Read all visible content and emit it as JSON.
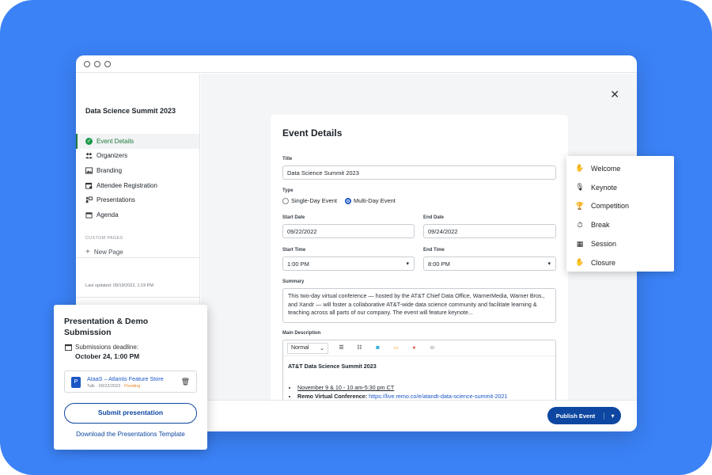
{
  "colors": {
    "background": "#3b82f6",
    "primary": "#0d47a1",
    "active_nav": "#1f7a3a",
    "pending": "#e6862a"
  },
  "sidebar": {
    "event_title": "Data Science Summit 2023",
    "items": [
      {
        "label": "Event Details",
        "icon": "check-circle-icon",
        "active": true
      },
      {
        "label": "Organizers",
        "icon": "people-icon"
      },
      {
        "label": "Branding",
        "icon": "image-icon"
      },
      {
        "label": "Attendee Registration",
        "icon": "calendar-user-icon"
      },
      {
        "label": "Presentations",
        "icon": "presenter-icon"
      },
      {
        "label": "Agenda",
        "icon": "calendar-icon"
      }
    ],
    "custom_pages_label": "CUSTOM PAGES",
    "new_page_label": "New Page",
    "last_updated": "Last updated: 09/19/2022, 1:19 PM"
  },
  "form": {
    "heading": "Event Details",
    "title_label": "Title",
    "title_value": "Data Science Summit 2023",
    "type_label": "Type",
    "type_options": [
      "Single-Day Event",
      "Multi-Day Event"
    ],
    "type_selected": "Multi-Day Event",
    "start_date_label": "Start Date",
    "start_date": "09/22/2022",
    "end_date_label": "End Date",
    "end_date": "09/24/2022",
    "start_time_label": "Start Time",
    "start_time": "1:00 PM",
    "end_time_label": "End Time",
    "end_time": "8:00 PM",
    "summary_label": "Summary",
    "summary": "This two-day virtual conference — hosted by the AT&T Chief Data Office, WarnerMedia, Warner Bros., and Xandr — will foster a collaborative AT&T-wide data science community and facilitate learning & teaching across all parts of our company. The event will feature keynote...",
    "main_description_label": "Main Description",
    "editor": {
      "format": "Normal",
      "heading": "AT&T Data Science Summit 2023",
      "bullet1": "November 9 & 10 - 10 am-5:30 pm CT",
      "bullet2_label": "Remo Virtual Conference:",
      "bullet2_link": "https://live.remo.co/e/atandt-data-science-summit-2021"
    }
  },
  "footer": {
    "publish_label": "Publish Event"
  },
  "dropdown": {
    "items": [
      {
        "label": "Welcome",
        "icon": "waving-hand-icon"
      },
      {
        "label": "Keynote",
        "icon": "microphone-icon"
      },
      {
        "label": "Competition",
        "icon": "trophy-icon"
      },
      {
        "label": "Break",
        "icon": "timer-icon"
      },
      {
        "label": "Session",
        "icon": "presentation-icon"
      },
      {
        "label": "Closure",
        "icon": "waving-hand-icon"
      }
    ]
  },
  "popup": {
    "title": "Presentation & Demo Submission",
    "deadline_label": "Submissions deadline:",
    "deadline_value": "October 24, 1:00 PM",
    "file_name": "AIaaS – Atlantis Feature Store",
    "file_type": "Talk",
    "file_date": "09/22/2023",
    "file_status": "Pending",
    "submit_label": "Submit presentation",
    "download_label": "Download the Presentations Template"
  }
}
